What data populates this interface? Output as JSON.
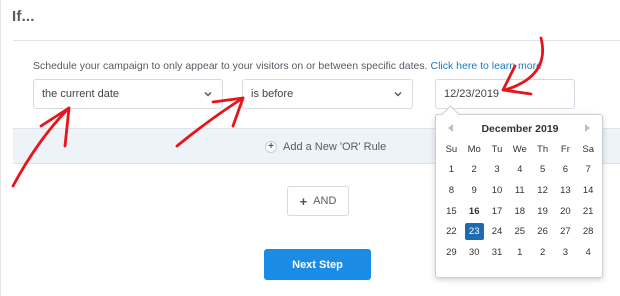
{
  "heading": "If...",
  "rule": {
    "description": "Schedule your campaign to only appear to your visitors on or between specific dates.",
    "learn_more": "Click here to learn more",
    "condition_select": "the current date",
    "operator_select": "is before",
    "date_value": "12/23/2019"
  },
  "add_or_rule": "Add a New 'OR' Rule",
  "and_button": "AND",
  "next_button": "Next Step",
  "calendar": {
    "month_label": "December 2019",
    "weekdays": [
      "Su",
      "Mo",
      "Tu",
      "We",
      "Th",
      "Fr",
      "Sa"
    ],
    "weeks": [
      [
        "1",
        "2",
        "3",
        "4",
        "5",
        "6",
        "7"
      ],
      [
        "8",
        "9",
        "10",
        "11",
        "12",
        "13",
        "14"
      ],
      [
        "15",
        "16",
        "17",
        "18",
        "19",
        "20",
        "21"
      ],
      [
        "22",
        "23",
        "24",
        "25",
        "26",
        "27",
        "28"
      ],
      [
        "29",
        "30",
        "31",
        "1",
        "2",
        "3",
        "4"
      ]
    ],
    "today": "16",
    "selected": "23"
  },
  "colors": {
    "accent": "#1b8ce6",
    "selected_day": "#1b6db0",
    "annotation": "#e8141c",
    "link": "#1a7bc3"
  }
}
